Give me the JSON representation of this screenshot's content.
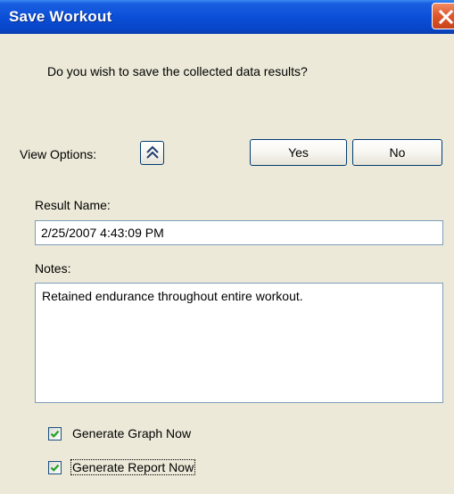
{
  "window": {
    "title": "Save Workout",
    "close_icon": "close-icon"
  },
  "dialog": {
    "question": "Do you wish to save the collected data results?",
    "view_options_label": "View Options:",
    "expand_icon": "double-chevron-up-icon",
    "yes_label": "Yes",
    "no_label": "No"
  },
  "result_name": {
    "label": "Result Name:",
    "value": "2/25/2007 4:43:09 PM"
  },
  "notes": {
    "label": "Notes:",
    "value": "Retained endurance throughout entire workout."
  },
  "options": [
    {
      "label": "Generate Graph Now",
      "checked": true
    },
    {
      "label": "Generate Report Now",
      "checked": true,
      "focused": true
    }
  ],
  "colors": {
    "titlebar": "#0a4fd8",
    "close_button": "#e05a2e",
    "dialog_background": "#ece9d8",
    "checkmark": "#21a121",
    "button_border": "#003c74",
    "input_border": "#7f9db9"
  }
}
